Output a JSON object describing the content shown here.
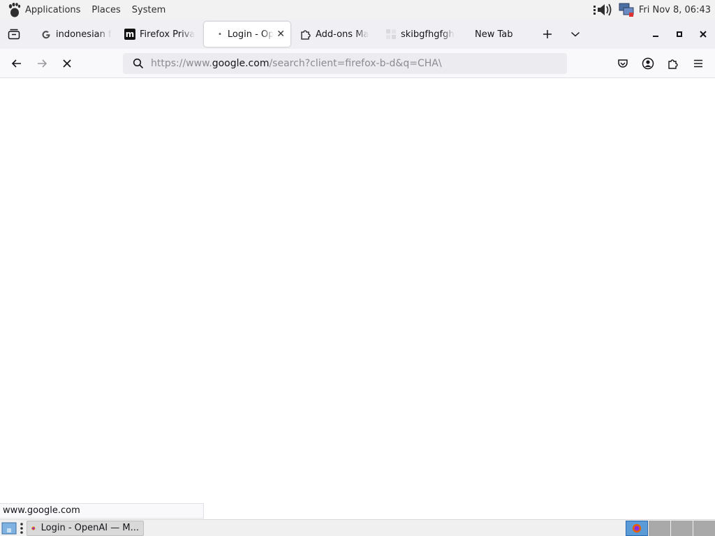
{
  "top_panel": {
    "menus": [
      "Applications",
      "Places",
      "System"
    ],
    "clock": "Fri Nov  8, 06:43"
  },
  "tabs": [
    {
      "label": "indonesian f",
      "icon": "google-g-icon",
      "active": false
    },
    {
      "label": "Firefox Priva",
      "icon": "mozilla-m-icon",
      "active": false
    },
    {
      "label": "Login - Op",
      "icon": "loading-dot-icon",
      "active": true
    },
    {
      "label": "Add-ons Ma",
      "icon": "puzzle-icon",
      "active": false
    },
    {
      "label": "skibgfhgfgh",
      "icon": "generic-page-icon",
      "active": false
    },
    {
      "label": "New Tab",
      "icon": "",
      "active": false
    }
  ],
  "urlbar": {
    "prefix": "https://www.",
    "domain": "google.com",
    "suffix": "/search?client=firefox-b-d&q=CHA\\"
  },
  "status_link": "www.google.com",
  "taskbar": {
    "window_title": "Login - OpenAI — M..."
  },
  "colors": {
    "accent": "#0060df",
    "panel_bg": "#f2f2f2",
    "tabstrip_bg": "#f0f0f4"
  }
}
